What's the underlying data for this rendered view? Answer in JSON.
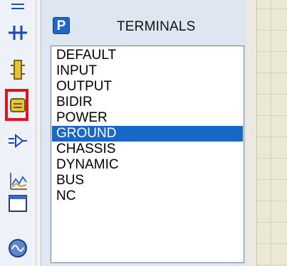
{
  "panel": {
    "badge": "P",
    "title": "TERMINALS",
    "items": [
      "DEFAULT",
      "INPUT",
      "OUTPUT",
      "BIDIR",
      "POWER",
      "GROUND",
      "CHASSIS",
      "DYNAMIC",
      "BUS",
      "NC"
    ],
    "selected_index": 5
  },
  "toolbar": {
    "icons": [
      "pin-icon",
      "junction-icon",
      "component-icon",
      "terminal-icon",
      "subcircuit-icon",
      "graph-icon",
      "window-icon",
      "generator-icon"
    ],
    "highlighted_index": 3
  },
  "colors": {
    "selection": "#1868c7",
    "highlight_box": "#e1141d",
    "badge": "#1f66c9"
  }
}
